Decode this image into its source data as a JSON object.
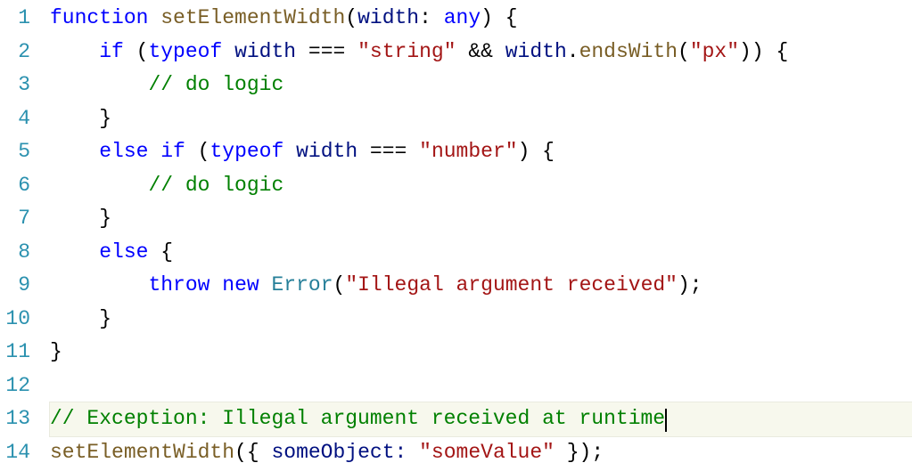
{
  "lines": [
    {
      "n": "1",
      "hl": false,
      "tokens": [
        {
          "cls": "kw",
          "t": "function"
        },
        {
          "cls": "plain",
          "t": " "
        },
        {
          "cls": "fn",
          "t": "setElementWidth"
        },
        {
          "cls": "plain",
          "t": "("
        },
        {
          "cls": "ident",
          "t": "width"
        },
        {
          "cls": "plain",
          "t": ": "
        },
        {
          "cls": "kw",
          "t": "any"
        },
        {
          "cls": "plain",
          "t": ") {"
        }
      ]
    },
    {
      "n": "2",
      "hl": false,
      "tokens": [
        {
          "cls": "guide",
          "t": "    "
        },
        {
          "cls": "kw",
          "t": "if"
        },
        {
          "cls": "plain",
          "t": " ("
        },
        {
          "cls": "kw",
          "t": "typeof"
        },
        {
          "cls": "plain",
          "t": " "
        },
        {
          "cls": "ident",
          "t": "width"
        },
        {
          "cls": "plain",
          "t": " === "
        },
        {
          "cls": "str",
          "t": "\"string\""
        },
        {
          "cls": "plain",
          "t": " && "
        },
        {
          "cls": "ident",
          "t": "width"
        },
        {
          "cls": "plain",
          "t": "."
        },
        {
          "cls": "method",
          "t": "endsWith"
        },
        {
          "cls": "plain",
          "t": "("
        },
        {
          "cls": "str",
          "t": "\"px\""
        },
        {
          "cls": "plain",
          "t": ")) {"
        }
      ]
    },
    {
      "n": "3",
      "hl": false,
      "tokens": [
        {
          "cls": "guide",
          "t": "    "
        },
        {
          "cls": "guide",
          "t": "    "
        },
        {
          "cls": "comm",
          "t": "// do logic"
        }
      ]
    },
    {
      "n": "4",
      "hl": false,
      "tokens": [
        {
          "cls": "guide",
          "t": "    "
        },
        {
          "cls": "plain",
          "t": "}"
        }
      ]
    },
    {
      "n": "5",
      "hl": false,
      "tokens": [
        {
          "cls": "guide",
          "t": "    "
        },
        {
          "cls": "kw",
          "t": "else"
        },
        {
          "cls": "plain",
          "t": " "
        },
        {
          "cls": "kw",
          "t": "if"
        },
        {
          "cls": "plain",
          "t": " ("
        },
        {
          "cls": "kw",
          "t": "typeof"
        },
        {
          "cls": "plain",
          "t": " "
        },
        {
          "cls": "ident",
          "t": "width"
        },
        {
          "cls": "plain",
          "t": " === "
        },
        {
          "cls": "str",
          "t": "\"number\""
        },
        {
          "cls": "plain",
          "t": ") {"
        }
      ]
    },
    {
      "n": "6",
      "hl": false,
      "tokens": [
        {
          "cls": "guide",
          "t": "    "
        },
        {
          "cls": "guide",
          "t": "    "
        },
        {
          "cls": "comm",
          "t": "// do logic"
        }
      ]
    },
    {
      "n": "7",
      "hl": false,
      "tokens": [
        {
          "cls": "guide",
          "t": "    "
        },
        {
          "cls": "plain",
          "t": "}"
        }
      ]
    },
    {
      "n": "8",
      "hl": false,
      "tokens": [
        {
          "cls": "guide",
          "t": "    "
        },
        {
          "cls": "kw",
          "t": "else"
        },
        {
          "cls": "plain",
          "t": " {"
        }
      ]
    },
    {
      "n": "9",
      "hl": false,
      "tokens": [
        {
          "cls": "guide",
          "t": "    "
        },
        {
          "cls": "guide",
          "t": "    "
        },
        {
          "cls": "kw",
          "t": "throw"
        },
        {
          "cls": "plain",
          "t": " "
        },
        {
          "cls": "kw",
          "t": "new"
        },
        {
          "cls": "plain",
          "t": " "
        },
        {
          "cls": "type",
          "t": "Error"
        },
        {
          "cls": "plain",
          "t": "("
        },
        {
          "cls": "str",
          "t": "\"Illegal argument received\""
        },
        {
          "cls": "plain",
          "t": ");"
        }
      ]
    },
    {
      "n": "10",
      "hl": false,
      "tokens": [
        {
          "cls": "guide",
          "t": "    "
        },
        {
          "cls": "plain",
          "t": "}"
        }
      ]
    },
    {
      "n": "11",
      "hl": false,
      "tokens": [
        {
          "cls": "plain",
          "t": "}"
        }
      ]
    },
    {
      "n": "12",
      "hl": false,
      "tokens": []
    },
    {
      "n": "13",
      "hl": true,
      "cursor": true,
      "tokens": [
        {
          "cls": "comm",
          "t": "// Exception: Illegal argument received at runtime"
        }
      ]
    },
    {
      "n": "14",
      "hl": false,
      "tokens": [
        {
          "cls": "method",
          "t": "setElementWidth"
        },
        {
          "cls": "plain",
          "t": "({ "
        },
        {
          "cls": "ident",
          "t": "someObject"
        },
        {
          "cls": "ident",
          "t": ":"
        },
        {
          "cls": "plain",
          "t": " "
        },
        {
          "cls": "str",
          "t": "\"someValue\""
        },
        {
          "cls": "plain",
          "t": " });"
        }
      ]
    }
  ]
}
